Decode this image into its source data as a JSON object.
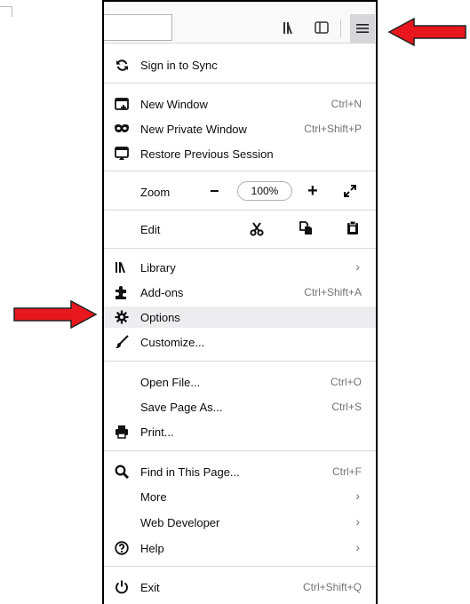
{
  "menu": {
    "sync": "Sign in to Sync",
    "new_window": {
      "label": "New Window",
      "shortcut": "Ctrl+N"
    },
    "new_private_window": {
      "label": "New Private Window",
      "shortcut": "Ctrl+Shift+P"
    },
    "restore_session": "Restore Previous Session",
    "zoom": {
      "label": "Zoom",
      "minus": "−",
      "value": "100%",
      "plus": "+"
    },
    "edit": "Edit",
    "library": "Library",
    "addons": {
      "label": "Add-ons",
      "shortcut": "Ctrl+Shift+A"
    },
    "options": "Options",
    "customize": "Customize...",
    "open_file": {
      "label": "Open File...",
      "shortcut": "Ctrl+O"
    },
    "save_page": {
      "label": "Save Page As...",
      "shortcut": "Ctrl+S"
    },
    "print": "Print...",
    "find": {
      "label": "Find in This Page...",
      "shortcut": "Ctrl+F"
    },
    "more": "More",
    "web_developer": "Web Developer",
    "help": "Help",
    "exit": {
      "label": "Exit",
      "shortcut": "Ctrl+Shift+Q"
    },
    "chevron": "›"
  },
  "colors": {
    "annotation_arrow": "#e8171d",
    "highlight": "#ededf0"
  }
}
